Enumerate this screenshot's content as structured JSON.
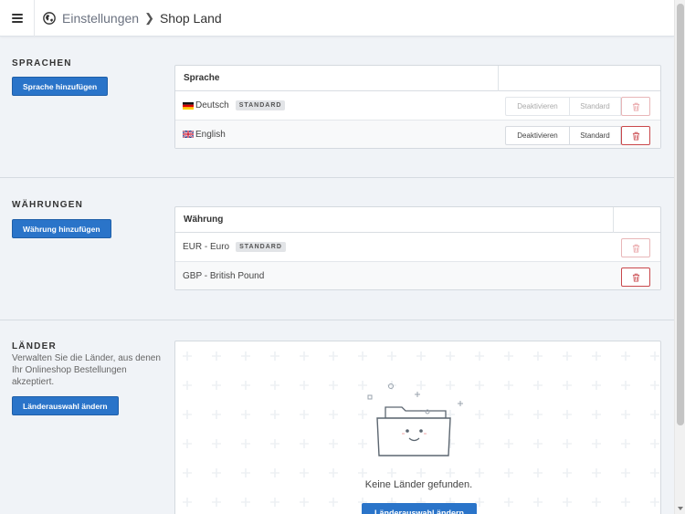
{
  "breadcrumb": {
    "parent": "Einstellungen",
    "current": "Shop Land"
  },
  "colors": {
    "primary": "#2a74c9",
    "danger": "#c9474b",
    "badge_bg": "#e2e4e7"
  },
  "languages": {
    "title": "SPRACHEN",
    "add_button": "Sprache hinzufügen",
    "column_header": "Sprache",
    "rows": [
      {
        "name": "Deutsch",
        "flag": "de-flag-icon",
        "badge": "STANDARD",
        "deactivate_label": "Deaktivieren",
        "standard_label": "Standard"
      },
      {
        "name": "English",
        "flag": "gb-flag-icon",
        "badge": "",
        "deactivate_label": "Deaktivieren",
        "standard_label": "Standard"
      }
    ]
  },
  "currencies": {
    "title": "WÄHRUNGEN",
    "add_button": "Währung hinzufügen",
    "column_header": "Währung",
    "rows": [
      {
        "name": "EUR - Euro",
        "badge": "STANDARD"
      },
      {
        "name": "GBP - British Pound",
        "badge": ""
      }
    ]
  },
  "countries": {
    "title": "LÄNDER",
    "description": "Verwalten Sie die Länder, aus denen Ihr Onlineshop Bestellungen akzeptiert.",
    "change_button": "Länderauswahl ändern",
    "empty_text": "Keine Länder gefunden.",
    "empty_button": "Länderauswahl ändern"
  }
}
